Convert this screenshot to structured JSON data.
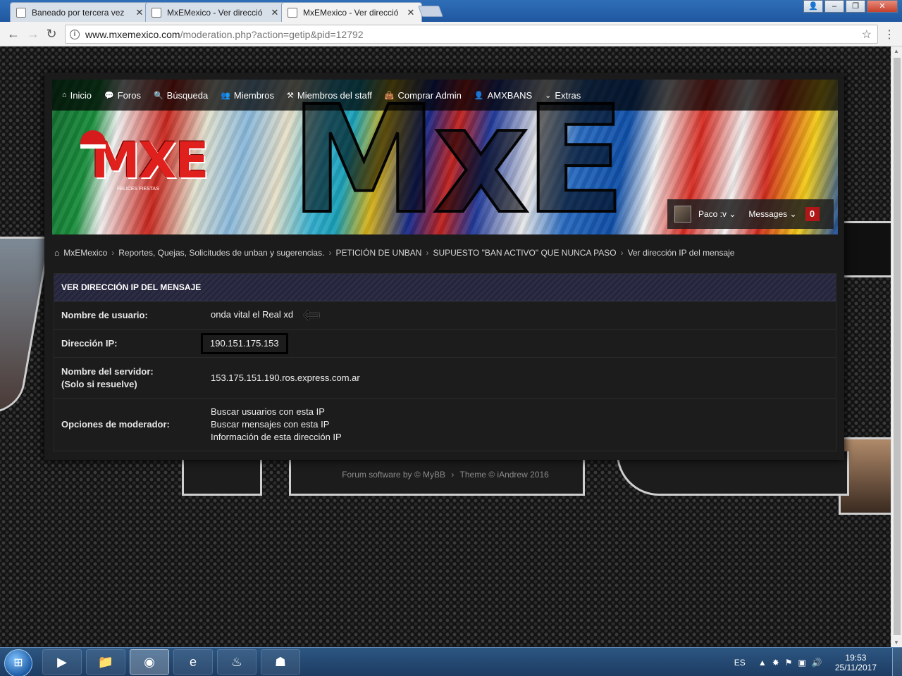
{
  "browser": {
    "tabs": [
      {
        "label": "Baneado por tercera vez",
        "active": false
      },
      {
        "label": "MxEMexico - Ver direcció",
        "active": false
      },
      {
        "label": "MxEMexico - Ver direcció",
        "active": true
      }
    ],
    "url_host": "www.mxemexico.com",
    "url_path": "/moderation.php?action=getip&pid=12792"
  },
  "nav": {
    "items": [
      {
        "icon": "home-icon",
        "label": "Inicio"
      },
      {
        "icon": "comments-icon",
        "label": "Foros"
      },
      {
        "icon": "search-icon",
        "label": "Búsqueda"
      },
      {
        "icon": "users-icon",
        "label": "Miembros"
      },
      {
        "icon": "gavel-icon",
        "label": "Miembros del staff"
      },
      {
        "icon": "shopping-bag-icon",
        "label": "Comprar Admin"
      },
      {
        "icon": "user-shield-icon",
        "label": "AMXBANS"
      },
      {
        "icon": "chevron-down-icon",
        "label": "Extras"
      }
    ]
  },
  "banner": {
    "logo_text": "MXE",
    "logo_subtitle": "FELICES FIESTAS",
    "big_text": "MxE"
  },
  "userbar": {
    "username": "Paco :v",
    "messages_label": "Messages",
    "message_count": "0"
  },
  "breadcrumb": [
    "MxEMexico",
    "Reportes, Quejas, Solicitudes de unban y sugerencias.",
    "PETICIÓN DE UNBAN",
    "SUPUESTO \"BAN ACTIVO\" QUE NUNCA PASO",
    "Ver dirección IP del mensaje"
  ],
  "panel": {
    "title": "VER DIRECCIÓN IP DEL MENSAJE",
    "username_label": "Nombre de usuario:",
    "username_value": "onda vital el Real xd",
    "ip_label": "Dirección IP:",
    "ip_value": "190.151.175.153",
    "server_label_1": "Nombre del servidor:",
    "server_label_2": "(Solo si resuelve)",
    "server_value": "153.175.151.190.ros.express.com.ar",
    "mod_label": "Opciones de moderador:",
    "mod_options": [
      "Buscar usuarios con esta IP",
      "Buscar mensajes con esta IP",
      "Información de esta dirección IP"
    ]
  },
  "footer": {
    "software": "Forum software by © MyBB",
    "theme": "Theme © iAndrew 2016"
  },
  "taskbar": {
    "language": "ES",
    "time": "19:53",
    "date": "25/11/2017"
  }
}
